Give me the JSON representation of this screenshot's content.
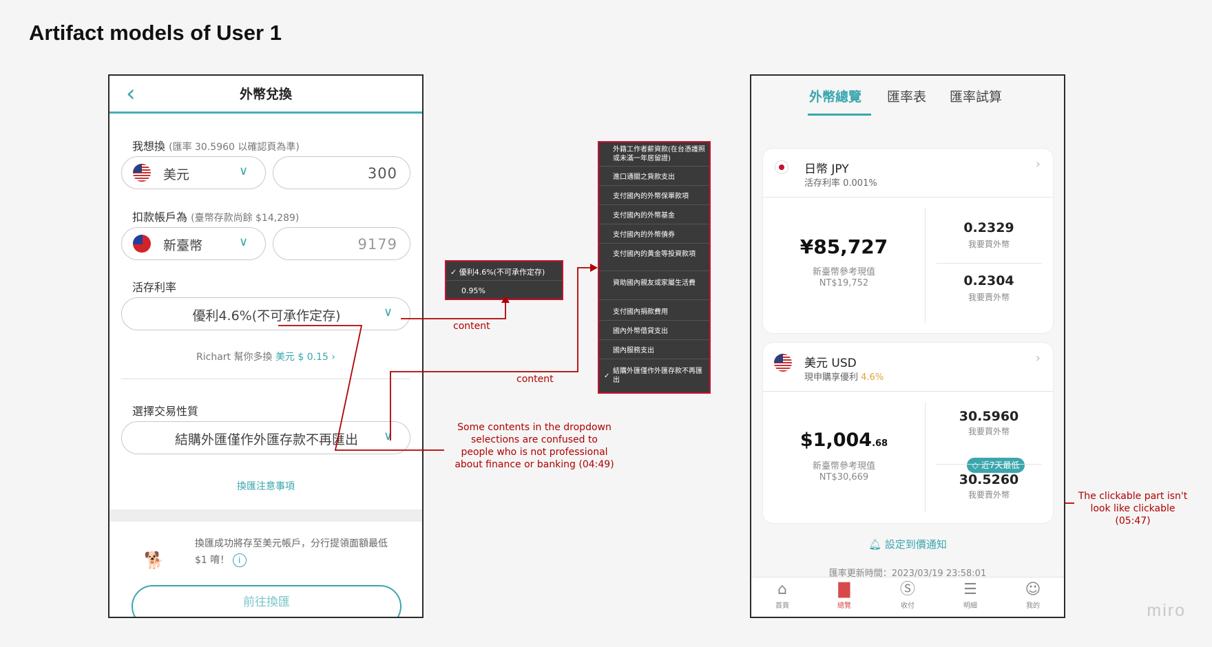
{
  "page_title": "Artifact models of User 1",
  "left_phone": {
    "header_title": "外幣兌換",
    "back_icon": "chevron-left-icon",
    "exchange_label": "我想換",
    "exchange_rate_note": "(匯率 30.5960 以確認頁為準)",
    "from_currency": "美元",
    "from_amount": "300",
    "debit_label": "扣款帳戶為",
    "debit_note": "(臺幣存款尚餘 $14,289)",
    "debit_currency": "新臺幣",
    "debit_amount": "9179",
    "rate_label": "活存利率",
    "rate_selected": "優利4.6%(不可承作定存)",
    "richart_text": "Richart 幫你多換",
    "richart_amount": "美元 $ 0.15",
    "trade_label": "選擇交易性質",
    "trade_selected": "結購外匯僅作外匯存款不再匯出",
    "notice_link": "換匯注意事項",
    "footer_note": "換匯成功將存至美元帳戶，分行提領面額最低 $1 唷！",
    "cta_label": "前往換匯"
  },
  "rate_dropdown": {
    "items": [
      "優利4.6%(不可承作定存)",
      "0.95%"
    ],
    "checked_index": 0
  },
  "trade_dropdown": {
    "items": [
      "外籍工作者薪資款(在台憑護照或未滿一年居留證)",
      "進口通關之貨款支出",
      "支付國內的外幣保單款項",
      "支付國內的外幣基金",
      "支付國內的外幣債券",
      "支付國內的黃金等投資款項",
      "資助國內親友或家屬生活費",
      "支付國內捐款費用",
      "國內外幣借貸支出",
      "國內服務支出",
      "結購外匯僅作外匯存款不再匯出"
    ],
    "checked_index": 10
  },
  "annotations": {
    "content_1": "content",
    "content_2": "content",
    "dropdown_note": "Some contents in the dropdown selections are confused to people who is not professional about finance or banking (04:49)",
    "clickable_note": "The clickable part isn't look like clickable (05:47)"
  },
  "right_phone": {
    "tabs": [
      "外幣總覽",
      "匯率表",
      "匯率試算"
    ],
    "active_tab": 0,
    "jpy": {
      "name": "日幣 JPY",
      "sub": "活存利率 0.001%",
      "amount": "¥85,727",
      "amount_label": "新臺幣參考現值",
      "amount_twd": "NT$19,752",
      "buy_rate": "0.2329",
      "buy_label": "我要買外幣",
      "sell_rate": "0.2304",
      "sell_label": "我要賣外幣"
    },
    "usd": {
      "name": "美元 USD",
      "sub": "現申購享優利",
      "sub_rate": "4.6%",
      "amount_main": "$1,004",
      "amount_decimal": ".68",
      "amount_label": "新臺幣參考現值",
      "amount_twd": "NT$30,669",
      "buy_rate": "30.5960",
      "buy_label": "我要買外幣",
      "badge": "近7天最低",
      "sell_rate": "30.5260",
      "sell_label": "我要賣外幣"
    },
    "alert_link": "設定到價通知",
    "update_time": "匯率更新時間：2023/03/19 23:58:01",
    "nav": [
      {
        "label": "首頁",
        "icon": "home-icon"
      },
      {
        "label": "總覽",
        "icon": "chart-icon"
      },
      {
        "label": "收付",
        "icon": "dollar-icon"
      },
      {
        "label": "明細",
        "icon": "receipt-icon"
      },
      {
        "label": "我的",
        "icon": "user-icon"
      }
    ],
    "active_nav": 1
  },
  "watermark": "miro",
  "colors": {
    "accent": "#3aa6ad",
    "annotation": "#b00000",
    "popup": "#3a3a3a"
  }
}
